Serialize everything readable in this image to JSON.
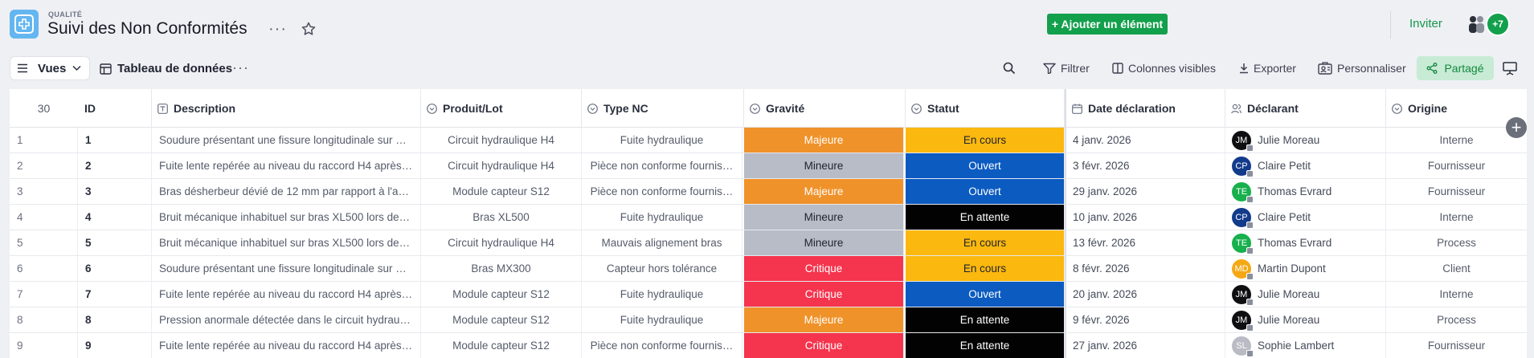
{
  "header": {
    "overline": "QUALITÉ",
    "title": "Suivi des Non Conformités",
    "more_dots": "···",
    "add_button": "+ Ajouter un élément",
    "invite": "Inviter",
    "more_users": "+7",
    "add_color": "#13a04c"
  },
  "toolbar": {
    "views_label": "Vues",
    "view_name": "Tableau de données",
    "view_dots": "···",
    "filter": "Filtrer",
    "visible_columns": "Colonnes visibles",
    "export": "Exporter",
    "customize": "Personnaliser",
    "share": "Partagé"
  },
  "table": {
    "count": "30",
    "columns": {
      "id": "ID",
      "description": "Description",
      "product": "Produit/Lot",
      "type": "Type NC",
      "severity": "Gravité",
      "status": "Statut",
      "date": "Date déclaration",
      "reporter": "Déclarant",
      "origin": "Origine"
    },
    "severity_colors": {
      "Majeure": "#f0922a",
      "Mineure": "#b7bcc6",
      "Critique": "#f5344d"
    },
    "status_colors": {
      "En cours": "#fbb80e",
      "Ouvert": "#0b5bc1",
      "En attente": "#020202"
    },
    "rows": [
      {
        "num": "1",
        "id": "1",
        "description": "Soudure présentant une fissure longitudinale sur …",
        "product": "Circuit hydraulique H4",
        "type": "Fuite hydraulique",
        "severity": "Majeure",
        "status": "En cours",
        "date": "4 janv. 2026",
        "reporter": "Julie Moreau",
        "initials": "JM",
        "avatar_color": "#0f0f12",
        "origin": "Interne"
      },
      {
        "num": "2",
        "id": "2",
        "description": "Fuite lente repérée au niveau du raccord H4 après…",
        "product": "Circuit hydraulique H4",
        "type": "Pièce non conforme fournis…",
        "severity": "Mineure",
        "status": "Ouvert",
        "date": "3 févr. 2026",
        "reporter": "Claire Petit",
        "initials": "CP",
        "avatar_color": "#123b8c",
        "origin": "Fournisseur"
      },
      {
        "num": "3",
        "id": "3",
        "description": "Bras désherbeur dévié de 12 mm par rapport à l'a…",
        "product": "Module capteur S12",
        "type": "Pièce non conforme fournis…",
        "severity": "Majeure",
        "status": "Ouvert",
        "date": "29 janv. 2026",
        "reporter": "Thomas Evrard",
        "initials": "TE",
        "avatar_color": "#17b04d",
        "origin": "Fournisseur"
      },
      {
        "num": "4",
        "id": "4",
        "description": "Bruit mécanique inhabituel sur bras XL500 lors de…",
        "product": "Bras XL500",
        "type": "Fuite hydraulique",
        "severity": "Mineure",
        "status": "En attente",
        "date": "10 janv. 2026",
        "reporter": "Claire Petit",
        "initials": "CP",
        "avatar_color": "#123b8c",
        "origin": "Interne"
      },
      {
        "num": "5",
        "id": "5",
        "description": "Bruit mécanique inhabituel sur bras XL500 lors de…",
        "product": "Circuit hydraulique H4",
        "type": "Mauvais alignement bras",
        "severity": "Mineure",
        "status": "En cours",
        "date": "13 févr. 2026",
        "reporter": "Thomas Evrard",
        "initials": "TE",
        "avatar_color": "#17b04d",
        "origin": "Process"
      },
      {
        "num": "6",
        "id": "6",
        "description": "Soudure présentant une fissure longitudinale sur …",
        "product": "Bras MX300",
        "type": "Capteur hors tolérance",
        "severity": "Critique",
        "status": "En cours",
        "date": "8 févr. 2026",
        "reporter": "Martin Dupont",
        "initials": "MD",
        "avatar_color": "#f5a814",
        "origin": "Client"
      },
      {
        "num": "7",
        "id": "7",
        "description": "Fuite lente repérée au niveau du raccord H4 après…",
        "product": "Module capteur S12",
        "type": "Fuite hydraulique",
        "severity": "Critique",
        "status": "Ouvert",
        "date": "20 janv. 2026",
        "reporter": "Julie Moreau",
        "initials": "JM",
        "avatar_color": "#0f0f12",
        "origin": "Interne"
      },
      {
        "num": "8",
        "id": "8",
        "description": "Pression anormale détectée dans le circuit hydrau…",
        "product": "Module capteur S12",
        "type": "Fuite hydraulique",
        "severity": "Majeure",
        "status": "En attente",
        "date": "9 févr. 2026",
        "reporter": "Julie Moreau",
        "initials": "JM",
        "avatar_color": "#0f0f12",
        "origin": "Process"
      },
      {
        "num": "9",
        "id": "9",
        "description": "Fuite lente repérée au niveau du raccord H4 après…",
        "product": "Module capteur S12",
        "type": "Pièce non conforme fournis…",
        "severity": "Critique",
        "status": "En attente",
        "date": "27 janv. 2026",
        "reporter": "Sophie Lambert",
        "initials": "SL",
        "avatar_color": "#b9bcc4",
        "origin": "Fournisseur"
      }
    ]
  }
}
